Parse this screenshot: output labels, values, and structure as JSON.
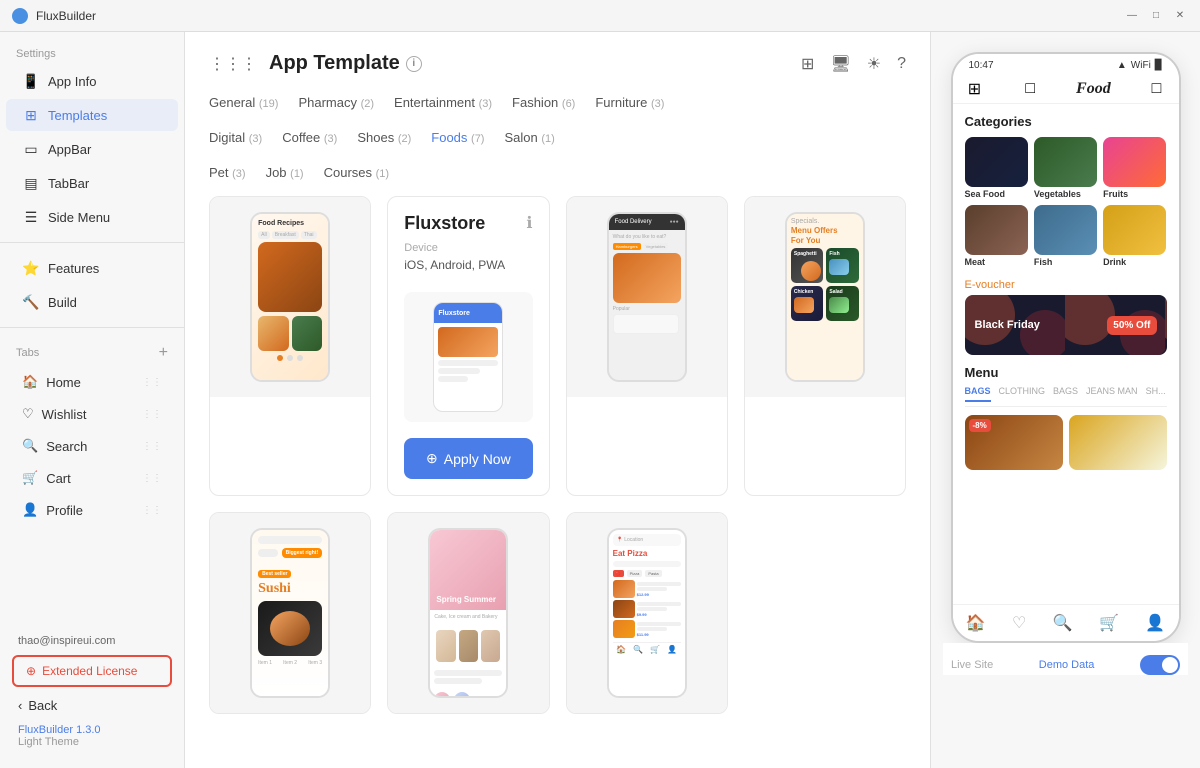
{
  "app": {
    "title": "FluxBuilder"
  },
  "titlebar": {
    "title": "FluxBuilder",
    "minimize": "—",
    "maximize": "□",
    "close": "✕"
  },
  "sidebar": {
    "settings_label": "Settings",
    "app_info_label": "App Info",
    "templates_label": "Templates",
    "appbar_label": "AppBar",
    "tabbar_label": "TabBar",
    "side_menu_label": "Side Menu",
    "features_label": "Features",
    "build_label": "Build",
    "tabs_label": "Tabs",
    "tabs": [
      {
        "label": "Home",
        "icon": "🏠"
      },
      {
        "label": "Wishlist",
        "icon": "♡"
      },
      {
        "label": "Search",
        "icon": "🔍"
      },
      {
        "label": "Cart",
        "icon": "🛒"
      },
      {
        "label": "Profile",
        "icon": "👤"
      }
    ],
    "user_email": "thao@inspireui.com",
    "extended_license_label": "Extended License",
    "back_label": "Back",
    "version_label": "FluxBuilder 1.3.0",
    "theme_label": "Light Theme"
  },
  "main": {
    "page_title": "App Template",
    "category_row1": [
      {
        "label": "General",
        "count": "(19)",
        "active": false
      },
      {
        "label": "Pharmacy",
        "count": "(2)",
        "active": false
      },
      {
        "label": "Entertainment",
        "count": "(3)",
        "active": false
      },
      {
        "label": "Fashion",
        "count": "(6)",
        "active": false
      },
      {
        "label": "Furniture",
        "count": "(3)",
        "active": false
      }
    ],
    "category_row2": [
      {
        "label": "Digital",
        "count": "(3)",
        "active": false
      },
      {
        "label": "Coffee",
        "count": "(3)",
        "active": false
      },
      {
        "label": "Shoes",
        "count": "(2)",
        "active": false
      },
      {
        "label": "Foods",
        "count": "(7)",
        "active": true
      },
      {
        "label": "Salon",
        "count": "(1)",
        "active": false
      }
    ],
    "category_row3": [
      {
        "label": "Pet",
        "count": "(3)",
        "active": false
      },
      {
        "label": "Job",
        "count": "(1)",
        "active": false
      },
      {
        "label": "Courses",
        "count": "(1)",
        "active": false
      }
    ],
    "fluxstore_card": {
      "title": "Fluxstore",
      "device_label": "Device",
      "device_value": "iOS, Android, PWA",
      "apply_btn": "Apply Now"
    }
  },
  "phone": {
    "time": "10:47",
    "title": "Food",
    "categories_title": "Categories",
    "categories": [
      {
        "name": "Sea Food",
        "color_start": "#1a1a2e",
        "color_end": "#16213e"
      },
      {
        "name": "Vegetables",
        "color_start": "#2d5a27",
        "color_end": "#4a7c4e"
      },
      {
        "name": "Fruits",
        "color_start": "#e84393",
        "color_end": "#ff6b35"
      },
      {
        "name": "Meat",
        "color_start": "#5a3e2b",
        "color_end": "#8b6355"
      },
      {
        "name": "Fish",
        "color_start": "#3d6b8c",
        "color_end": "#5a8fb5"
      },
      {
        "name": "Drink",
        "color_start": "#d4a017",
        "color_end": "#f0c040"
      }
    ],
    "evoucher_label": "E-voucher",
    "evoucher_text": "Black Friday",
    "evoucher_discount": "50% Off",
    "menu_title": "Menu",
    "menu_tabs": [
      "BAGS",
      "CLOTHING",
      "BAGS",
      "JEANS MAN",
      "SH..."
    ],
    "menu_active_tab": "BAGS",
    "product_badge": "-8%",
    "live_site_label": "Live Site",
    "demo_data_label": "Demo Data"
  }
}
